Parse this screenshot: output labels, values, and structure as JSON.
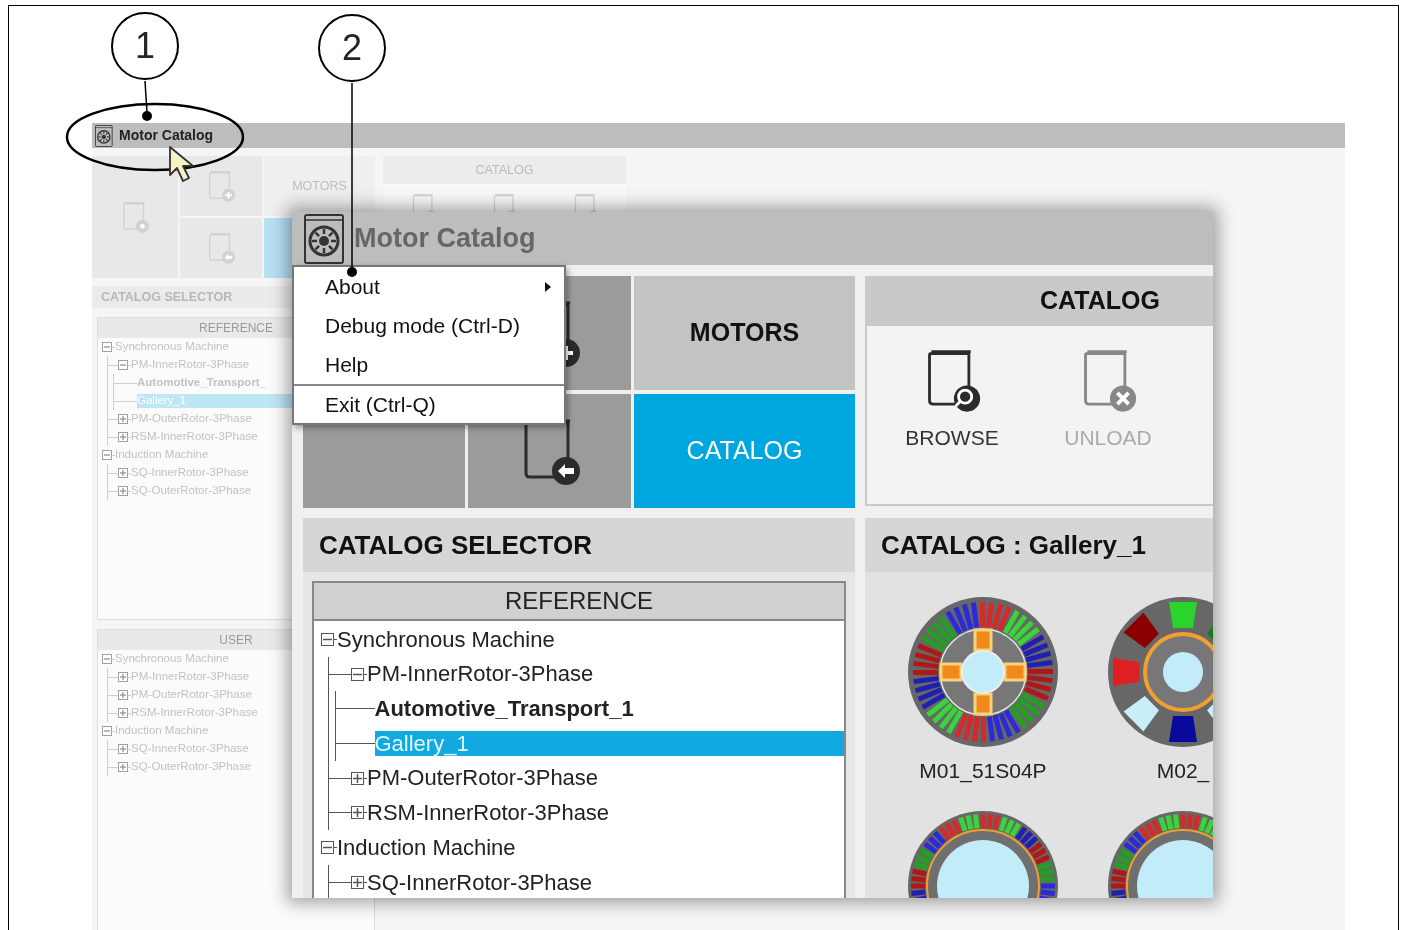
{
  "figure": {
    "callouts": [
      {
        "number": "1"
      },
      {
        "number": "2"
      }
    ]
  },
  "background_window": {
    "title": "Motor Catalog",
    "ribbon_tabs": [
      {
        "label": "MOTORS",
        "selected": false
      },
      {
        "selected": true
      }
    ],
    "catalog_group": {
      "title": "CATALOG"
    },
    "selector": {
      "title": "CATALOG SELECTOR",
      "reference": {
        "title": "REFERENCE",
        "tree": [
          {
            "label": "Synchronous Machine",
            "expanded": true,
            "selected": false,
            "children": [
              {
                "label": "PM-InnerRotor-3Phase",
                "expanded": true,
                "selected": false,
                "children": [
                  {
                    "label": "Automotive_Transport_",
                    "bold": true,
                    "selected": false
                  },
                  {
                    "label": "Gallery_1",
                    "bold": false,
                    "selected": true
                  }
                ]
              },
              {
                "label": "PM-OuterRotor-3Phase",
                "expanded": false,
                "selected": false
              },
              {
                "label": "RSM-InnerRotor-3Phase",
                "expanded": false,
                "selected": false
              }
            ]
          },
          {
            "label": "Induction Machine",
            "expanded": true,
            "selected": false,
            "children": [
              {
                "label": "SQ-InnerRotor-3Phase",
                "expanded": false,
                "selected": false
              },
              {
                "label": "SQ-OuterRotor-3Phase",
                "expanded": false,
                "selected": false
              }
            ]
          }
        ]
      },
      "user": {
        "title": "USER",
        "tree": [
          {
            "label": "Synchronous Machine",
            "expanded": true,
            "selected": false,
            "children": [
              {
                "label": "PM-InnerRotor-3Phase",
                "expanded": false,
                "selected": false
              },
              {
                "label": "PM-OuterRotor-3Phase",
                "expanded": false,
                "selected": false
              },
              {
                "label": "RSM-InnerRotor-3Phase",
                "expanded": false,
                "selected": false
              }
            ]
          },
          {
            "label": "Induction Machine",
            "expanded": true,
            "selected": false,
            "children": [
              {
                "label": "SQ-InnerRotor-3Phase",
                "expanded": false,
                "selected": false
              },
              {
                "label": "SQ-OuterRotor-3Phase",
                "expanded": false,
                "selected": false
              }
            ]
          }
        ]
      }
    }
  },
  "window": {
    "title": "Motor Catalog",
    "menu": [
      {
        "label": "About",
        "submenu": true,
        "separator_before": false
      },
      {
        "label": "Debug mode (Ctrl-D)",
        "submenu": false,
        "separator_before": false
      },
      {
        "label": "Help",
        "submenu": false,
        "separator_before": false
      },
      {
        "label": "Exit (Ctrl-Q)",
        "submenu": false,
        "separator_before": true
      }
    ],
    "ribbon": {
      "tabs": [
        {
          "label": "MOTORS",
          "selected": false
        },
        {
          "label": "CATALOG",
          "selected": true
        }
      ],
      "catalog_group": {
        "title": "CATALOG",
        "buttons": [
          {
            "label": "BROWSE",
            "kind": "browse",
            "disabled": false
          },
          {
            "label": "UNLOAD",
            "kind": "unload",
            "disabled": true
          }
        ]
      }
    },
    "selector": {
      "title": "CATALOG SELECTOR",
      "reference": {
        "title": "REFERENCE",
        "tree": [
          {
            "label": "Synchronous Machine",
            "expanded": true,
            "selected": false,
            "children": [
              {
                "label": "PM-InnerRotor-3Phase",
                "expanded": true,
                "selected": false,
                "children": [
                  {
                    "label": "Automotive_Transport_1",
                    "bold": true,
                    "selected": false
                  },
                  {
                    "label": "Gallery_1",
                    "bold": false,
                    "selected": true
                  }
                ]
              },
              {
                "label": "PM-OuterRotor-3Phase",
                "expanded": false,
                "selected": false
              },
              {
                "label": "RSM-InnerRotor-3Phase",
                "expanded": false,
                "selected": false
              }
            ]
          },
          {
            "label": "Induction Machine",
            "expanded": true,
            "selected": false,
            "children": [
              {
                "label": "SQ-InnerRotor-3Phase",
                "expanded": false,
                "selected": false
              }
            ]
          }
        ]
      }
    },
    "gallery": {
      "title": "CATALOG : Gallery_1",
      "motors": [
        {
          "label": "M01_51S04P",
          "kind": "magnet-rotor"
        },
        {
          "label": "M02_",
          "kind": "segmented-rotor"
        },
        {
          "kind": "cage-rotor"
        },
        {
          "kind": "cage-rotor"
        }
      ]
    }
  }
}
